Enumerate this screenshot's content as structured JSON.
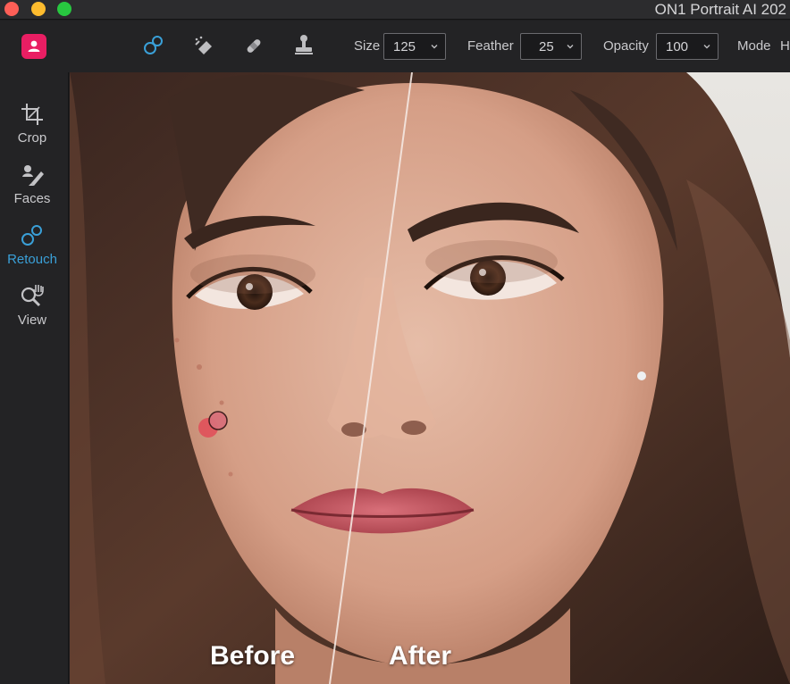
{
  "window": {
    "title": "ON1 Portrait AI 202"
  },
  "toolbar": {
    "size_label": "Size",
    "size_value": "125",
    "feather_label": "Feather",
    "feather_value": "25",
    "opacity_label": "Opacity",
    "opacity_value": "100",
    "mode_label": "Mode",
    "mode_value": "H",
    "tools": [
      {
        "icon": "retouch-brush-icon",
        "active": true
      },
      {
        "icon": "eraser-icon",
        "active": false
      },
      {
        "icon": "bandage-icon",
        "active": false
      },
      {
        "icon": "clone-stamp-icon",
        "active": false
      }
    ]
  },
  "sidebar": {
    "items": [
      {
        "label": "Crop",
        "icon": "crop-icon",
        "active": false
      },
      {
        "label": "Faces",
        "icon": "faces-icon",
        "active": false
      },
      {
        "label": "Retouch",
        "icon": "retouch-icon",
        "active": true
      },
      {
        "label": "View",
        "icon": "zoom-hand-icon",
        "active": false
      }
    ]
  },
  "canvas": {
    "before_label": "Before",
    "after_label": "After"
  },
  "colors": {
    "accent": "#3aa0d8",
    "logo": "#e91e63",
    "brush_cursor": "#e0505a"
  }
}
